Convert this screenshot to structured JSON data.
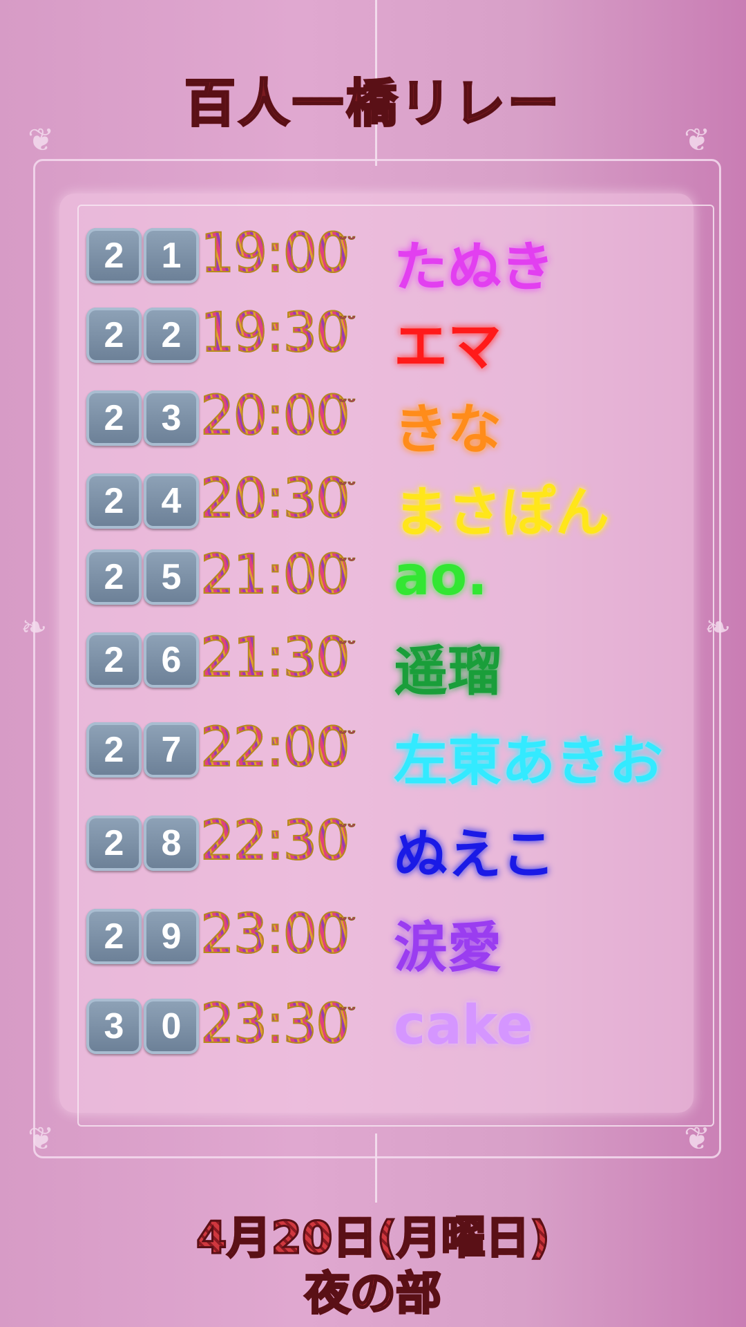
{
  "title": "百人一橋リレー",
  "footer": {
    "date": "4月20日(月曜日)",
    "session": "夜の部"
  },
  "time_suffix": "ᵕᵕ",
  "schedule": [
    {
      "num": [
        "2",
        "1"
      ],
      "time": "19:00",
      "name": "たぬき",
      "color": "#e23ff0"
    },
    {
      "num": [
        "2",
        "2"
      ],
      "time": "19:30",
      "name": "エマ",
      "color": "#ff1a1a"
    },
    {
      "num": [
        "2",
        "3"
      ],
      "time": "20:00",
      "name": "きな",
      "color": "#ff8c1a"
    },
    {
      "num": [
        "2",
        "4"
      ],
      "time": "20:30",
      "name": "まさぽん",
      "color": "#ffe61a"
    },
    {
      "num": [
        "2",
        "5"
      ],
      "time": "21:00",
      "name": "ao.",
      "color": "#33e633"
    },
    {
      "num": [
        "2",
        "6"
      ],
      "time": "21:30",
      "name": "遥瑠",
      "color": "#1a9e3a"
    },
    {
      "num": [
        "2",
        "7"
      ],
      "time": "22:00",
      "name": "左東あきお",
      "color": "#33eaff"
    },
    {
      "num": [
        "2",
        "8"
      ],
      "time": "22:30",
      "name": "ぬえこ",
      "color": "#1a1ae6"
    },
    {
      "num": [
        "2",
        "9"
      ],
      "time": "23:00",
      "name": "涙愛",
      "color": "#9a3df0"
    },
    {
      "num": [
        "3",
        "0"
      ],
      "time": "23:30",
      "name": "cake",
      "color": "#d596ff"
    }
  ]
}
